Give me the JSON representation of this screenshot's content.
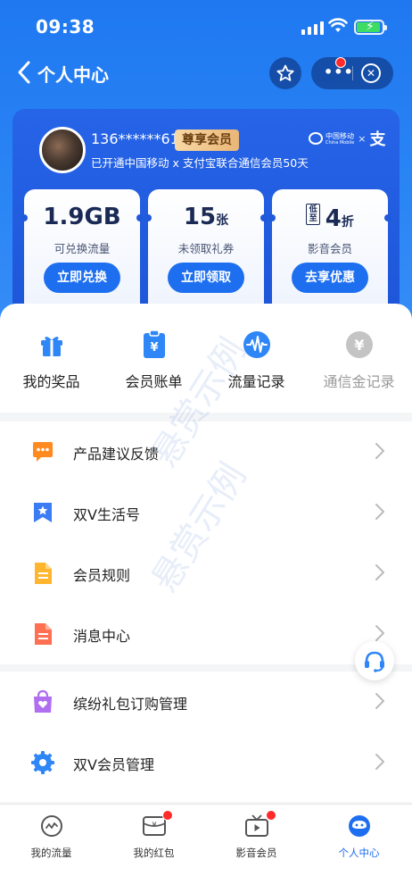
{
  "status_bar": {
    "time": "09:38"
  },
  "nav": {
    "title": "个人中心"
  },
  "member": {
    "phone": "136******61",
    "tag": "尊享会员",
    "description": "已开通中国移动 x 支付宝联合通信会员50天",
    "partner_brand": "中国移动",
    "partner_brand_en": "China Mobile",
    "partner_cross": "×",
    "partner_alipay": "支"
  },
  "benefits": [
    {
      "value": "1.9GB",
      "unit": "",
      "label": "可兑换流量",
      "button": "立即兑换"
    },
    {
      "value": "15",
      "unit": "张",
      "label": "未领取礼券",
      "button": "立即领取"
    },
    {
      "prefix": "低至",
      "value": "4",
      "unit": "折",
      "label": "影音会员",
      "button": "去享优惠"
    }
  ],
  "quick_actions": [
    {
      "label": "我的奖品",
      "icon": "gift-icon"
    },
    {
      "label": "会员账单",
      "icon": "bill-icon"
    },
    {
      "label": "流量记录",
      "icon": "traffic-wave-icon"
    },
    {
      "label": "通信金记录",
      "icon": "yen-coin-icon"
    }
  ],
  "menu_group_1": [
    {
      "label": "产品建议反馈",
      "icon": "feedback-chat-icon"
    },
    {
      "label": "双V生活号",
      "icon": "star-bookmark-icon"
    },
    {
      "label": "会员规则",
      "icon": "document-icon"
    },
    {
      "label": "消息中心",
      "icon": "message-document-icon"
    }
  ],
  "menu_group_2": [
    {
      "label": "缤纷礼包订购管理",
      "icon": "gift-bag-icon"
    },
    {
      "label": "双V会员管理",
      "icon": "gear-icon"
    }
  ],
  "tabs": [
    {
      "label": "我的流量",
      "icon": "traffic-icon",
      "badge": false
    },
    {
      "label": "我的红包",
      "icon": "red-packet-icon",
      "badge": true
    },
    {
      "label": "影音会员",
      "icon": "tv-play-icon",
      "badge": true
    },
    {
      "label": "个人中心",
      "icon": "user-face-icon",
      "badge": false,
      "active": true
    }
  ],
  "watermark": "悬赏示例",
  "colors": {
    "primary": "#1e6ff0",
    "header": "#1f78f0",
    "badge": "#ff2a2a",
    "vip_gold": "#e9b676"
  }
}
